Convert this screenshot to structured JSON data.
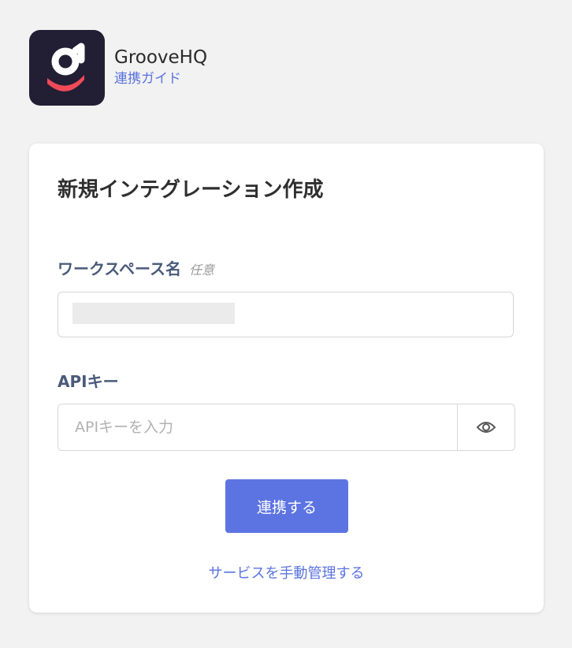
{
  "app": {
    "name": "GrooveHQ",
    "guide_link": "連携ガイド"
  },
  "form": {
    "title": "新規インテグレーション作成",
    "workspace": {
      "label": "ワークスペース名",
      "optional": "任意"
    },
    "api_key": {
      "label": "APIキー",
      "placeholder": "APIキーを入力"
    },
    "submit_label": "連携する",
    "manual_link": "サービスを手動管理する"
  },
  "icons": {
    "app_logo": "groove-logo-icon",
    "reveal": "eye-icon"
  },
  "colors": {
    "accent": "#5c74e2",
    "link": "#5a73e0",
    "logo_background": "#221e33",
    "logo_accent": "#f04a58"
  }
}
